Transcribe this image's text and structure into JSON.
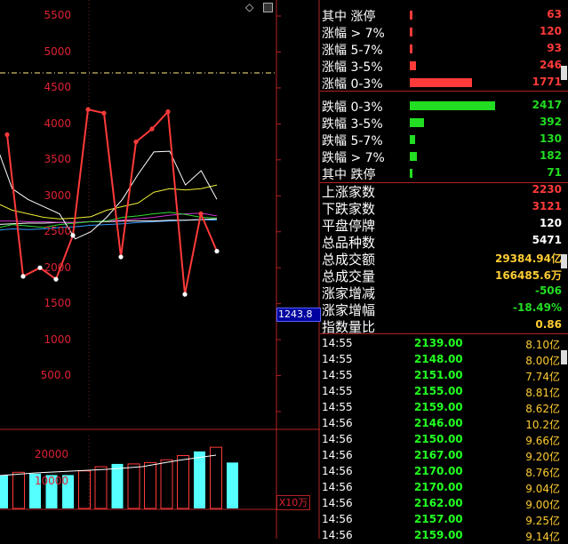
{
  "chart": {
    "price_axis_labels": [
      "5500",
      "5000",
      "4500",
      "4000",
      "3500",
      "3000",
      "2500",
      "2000",
      "1500",
      "1000",
      "500.0"
    ],
    "current_value_box": "1243.8",
    "volume_axis_labels": [
      "20000",
      "10000"
    ],
    "volume_unit": "X10万",
    "colors": {
      "axis": "#b22222",
      "up": "#ff3a3a",
      "down": "#55ffff",
      "box": "#0000a0"
    }
  },
  "chart_data": {
    "type": "line",
    "ylim": [
      0,
      5700
    ],
    "series": [
      {
        "values": [
          3850,
          1880,
          2000,
          1840,
          2450,
          4200,
          4150,
          2150,
          3750,
          3930,
          4170,
          1630,
          2750,
          2230
        ]
      },
      {
        "values": [
          3700,
          3100,
          2950,
          2850,
          2750,
          2400,
          2500,
          2700,
          2950,
          3300,
          3610,
          3620,
          3150,
          3350,
          2950
        ]
      },
      {
        "values": [
          2900,
          2800,
          2750,
          2700,
          2680,
          2690,
          2710,
          2800,
          2850,
          2900,
          3050,
          3100,
          3080,
          3100,
          3150
        ]
      },
      {
        "values": [
          2550,
          2600,
          2580,
          2560,
          2600,
          2620,
          2640,
          2650,
          2700,
          2720,
          2750,
          2770,
          2740,
          2700,
          2690
        ]
      },
      {
        "values": [
          2650,
          2650,
          2640,
          2640,
          2630,
          2630,
          2640,
          2650,
          2660,
          2680,
          2700,
          2730,
          2750,
          2760,
          2720
        ]
      },
      {
        "values": [
          2600,
          2610,
          2620,
          2620,
          2630,
          2630,
          2640,
          2640,
          2650,
          2650,
          2650,
          2660,
          2660,
          2670,
          2680
        ]
      },
      {
        "values": [
          2520,
          2540,
          2530,
          2540,
          2560,
          2570,
          2590,
          2600,
          2610,
          2630,
          2640,
          2650,
          2660,
          2670,
          2660
        ]
      }
    ],
    "volume": [
      12000,
      13000,
      12500,
      12000,
      12000,
      13500,
      15000,
      16000,
      16000,
      16500,
      17500,
      19000,
      20500,
      22000,
      16500
    ]
  },
  "stats": [
    {
      "label": "其中 涨停",
      "value": "63",
      "bar": 0.02,
      "color": "#ff3a3a"
    },
    {
      "label": "涨幅 > 7%",
      "value": "120",
      "bar": 0.03,
      "color": "#ff3a3a"
    },
    {
      "label": "涨幅 5-7%",
      "value": "93",
      "bar": 0.03,
      "color": "#ff3a3a"
    },
    {
      "label": "涨幅 3-5%",
      "value": "246",
      "bar": 0.07,
      "color": "#ff3a3a"
    },
    {
      "label": "涨幅 0-3%",
      "value": "1771",
      "bar": 0.73,
      "color": "#ff3a3a"
    },
    {
      "label": "跌幅 0-3%",
      "value": "2417",
      "bar": 1.0,
      "color": "#22dd22"
    },
    {
      "label": "跌幅 3-5%",
      "value": "392",
      "bar": 0.17,
      "color": "#22dd22"
    },
    {
      "label": "跌幅 5-7%",
      "value": "130",
      "bar": 0.06,
      "color": "#22dd22"
    },
    {
      "label": "跌幅 > 7%",
      "value": "182",
      "bar": 0.08,
      "color": "#22dd22"
    },
    {
      "label": "其中 跌停",
      "value": "71",
      "bar": 0.02,
      "color": "#22dd22"
    }
  ],
  "summary": [
    {
      "label": "上涨家数",
      "value": "2230",
      "color": "#ff3a3a"
    },
    {
      "label": "下跌家数",
      "value": "3121",
      "color": "#ff3a3a"
    },
    {
      "label": "平盘停牌",
      "value": "120",
      "color": "#ffffff"
    },
    {
      "label": "总品种数",
      "value": "5471",
      "color": "#ffffff"
    },
    {
      "label": "总成交额",
      "value": "29384.94亿",
      "color": "#ffcc33"
    },
    {
      "label": "总成交量",
      "value": "166485.6万",
      "color": "#ffcc33"
    },
    {
      "label": "涨家增减",
      "value": "-506",
      "color": "#22dd22"
    },
    {
      "label": "涨家增幅",
      "value": "-18.49%",
      "color": "#22dd22"
    },
    {
      "label": "指数量比",
      "value": "0.86",
      "color": "#ffcc33"
    }
  ],
  "ticks": [
    {
      "time": "14:55",
      "price": "2139.00",
      "vol": "8.10亿"
    },
    {
      "time": "14:55",
      "price": "2148.00",
      "vol": "8.00亿"
    },
    {
      "time": "14:55",
      "price": "2151.00",
      "vol": "7.74亿"
    },
    {
      "time": "14:55",
      "price": "2155.00",
      "vol": "8.81亿"
    },
    {
      "time": "14:55",
      "price": "2159.00",
      "vol": "8.62亿"
    },
    {
      "time": "14:56",
      "price": "2146.00",
      "vol": "10.2亿"
    },
    {
      "time": "14:56",
      "price": "2150.00",
      "vol": "9.66亿"
    },
    {
      "time": "14:56",
      "price": "2167.00",
      "vol": "9.20亿"
    },
    {
      "time": "14:56",
      "price": "2170.00",
      "vol": "8.76亿"
    },
    {
      "time": "14:56",
      "price": "2170.00",
      "vol": "9.04亿"
    },
    {
      "time": "14:56",
      "price": "2162.00",
      "vol": "9.00亿"
    },
    {
      "time": "14:56",
      "price": "2157.00",
      "vol": "9.25亿"
    },
    {
      "time": "14:56",
      "price": "2159.00",
      "vol": "9.14亿"
    }
  ]
}
